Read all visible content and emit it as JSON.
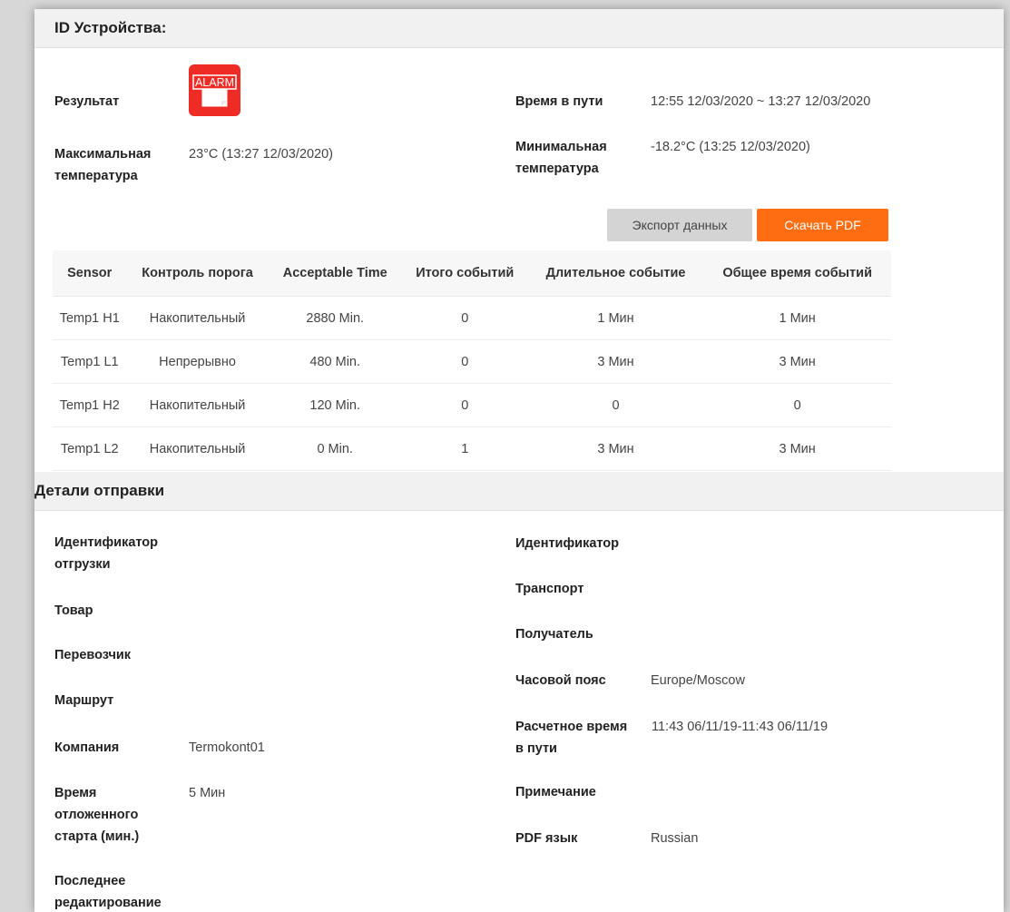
{
  "device": {
    "header_title": "ID Устройства:",
    "result_label": "Результат",
    "result_icon": "alarm-icon",
    "result_icon_text": "ALARM",
    "transit_time_label": "Время в пути",
    "transit_time_value": "12:55 12/03/2020 ~ 13:27 12/03/2020",
    "max_temp_label_line1": "Максимальная",
    "max_temp_label_line2": "температура",
    "max_temp_value": "23°C (13:27 12/03/2020)",
    "min_temp_label_line1": "Минимальная",
    "min_temp_label_line2": "температура",
    "min_temp_value": "-18.2°C (13:25 12/03/2020)"
  },
  "buttons": {
    "export_label": "Экспорт данных",
    "download_pdf_label": "Скачать PDF"
  },
  "colors": {
    "accent": "#ff6d12",
    "alarm": "#ee2b24",
    "header_bg": "#f1f1f1"
  },
  "sensor_table": {
    "columns": [
      "Sensor",
      "Контроль порога",
      "Acceptable Time",
      "Итого событий",
      "Длительное событие",
      "Общее время событий"
    ],
    "rows": [
      [
        "Temp1 H1",
        "Накопительный",
        "2880 Min.",
        "0",
        "1 Мин",
        "1 Мин"
      ],
      [
        "Temp1 L1",
        "Непрерывно",
        "480 Min.",
        "0",
        "3 Мин",
        "3 Мин"
      ],
      [
        "Temp1 H2",
        "Накопительный",
        "120 Min.",
        "0",
        "0",
        "0"
      ],
      [
        "Temp1 L2",
        "Накопительный",
        "0 Min.",
        "1",
        "3 Мин",
        "3 Мин"
      ]
    ]
  },
  "shipment": {
    "header_title": "Детали отправки",
    "shipment_id_label_line1": "Идентификатор",
    "shipment_id_label_line2": "отгрузки",
    "product_label": "Товар",
    "carrier_label": "Перевозчик",
    "route_label": "Маршрут",
    "company_label": "Компания",
    "company_value": "Termokont01",
    "delay_start_label_line1": "Время",
    "delay_start_label_line2": "отложенного",
    "delay_start_label_line3": "старта (мин.)",
    "delay_start_value": "5 Мин",
    "last_edit_label_line1": "Последнее",
    "last_edit_label_line2": "редактирование",
    "identifier_label": "Идентификатор",
    "transport_label": "Транспорт",
    "recipient_label": "Получатель",
    "timezone_label": "Часовой пояс",
    "timezone_value": "Europe/Moscow",
    "est_transit_label_line1": "Расчетное время",
    "est_transit_label_line2": "в пути",
    "est_transit_value": "11:43 06/11/19-11:43 06/11/19",
    "note_label": "Примечание",
    "pdf_lang_label": "PDF язык",
    "pdf_lang_value": "Russian"
  }
}
